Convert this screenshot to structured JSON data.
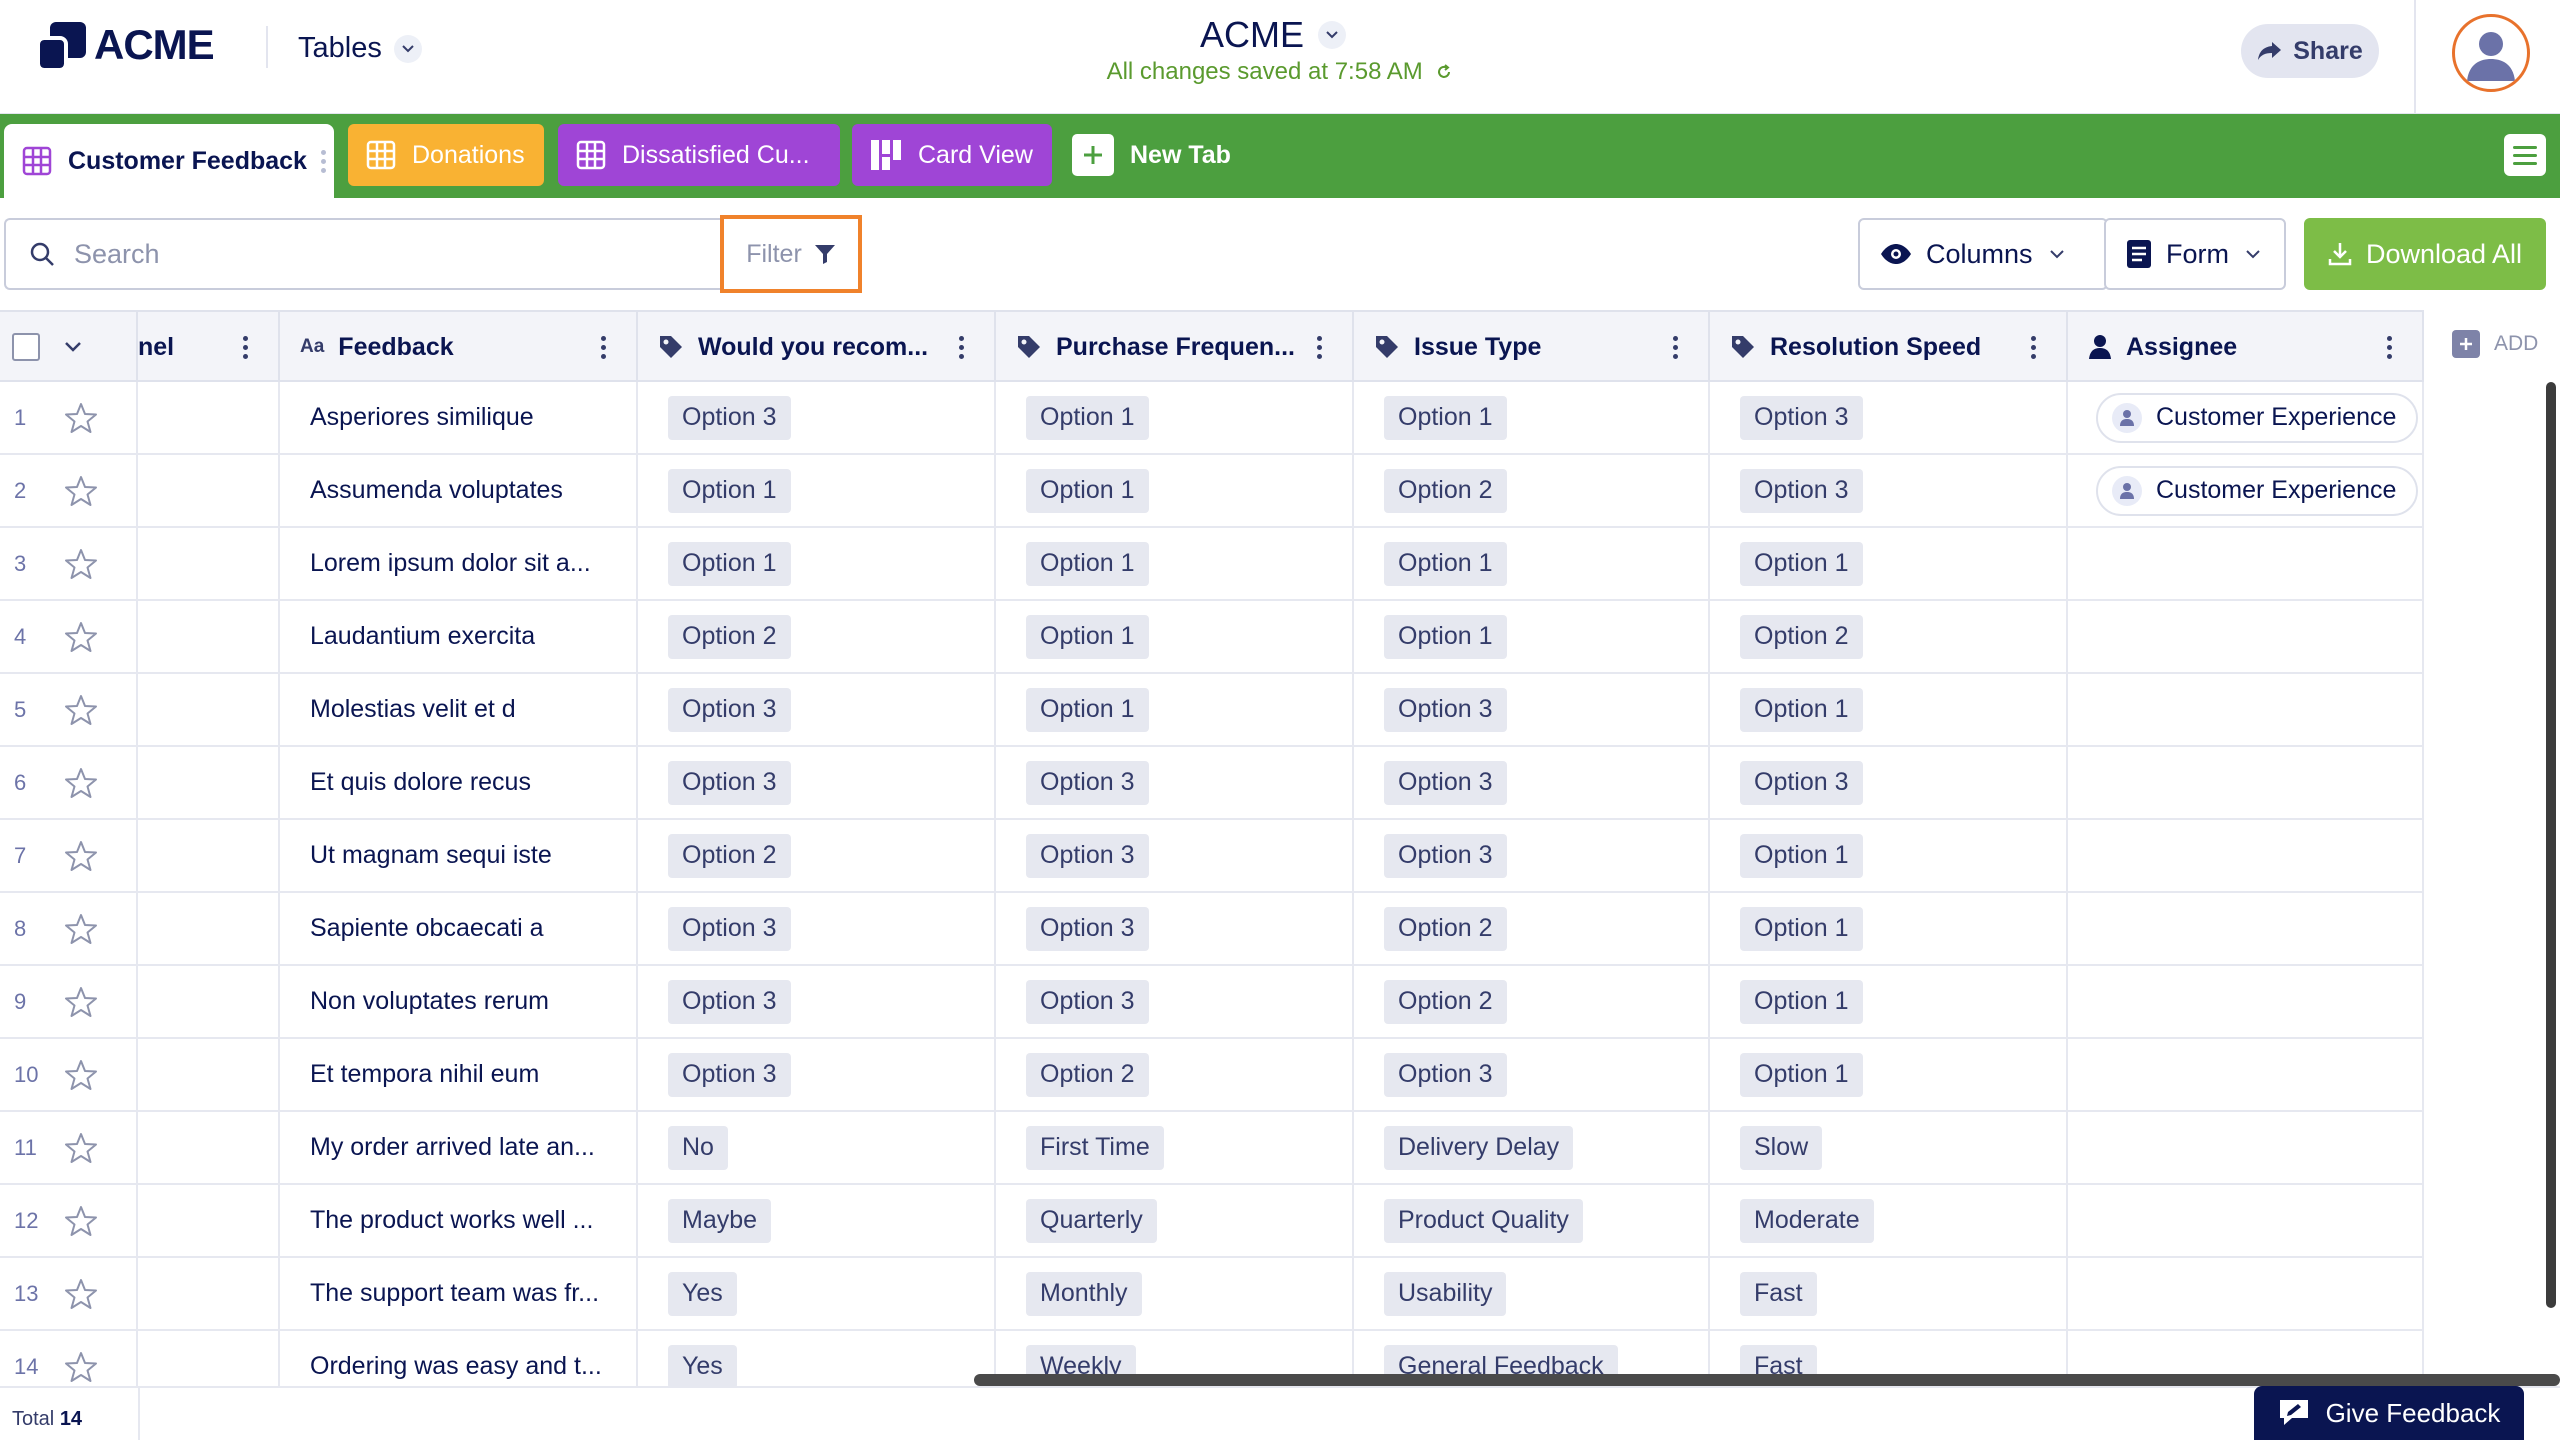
{
  "header": {
    "logo_text": "ACME",
    "tables_label": "Tables",
    "app_title": "ACME",
    "saved_status": "All changes saved at 7:58 AM",
    "share_label": "Share"
  },
  "tabs": [
    {
      "label": "Customer Feedback",
      "color": "#ffffff"
    },
    {
      "label": "Donations",
      "color": "#f9b233"
    },
    {
      "label": "Dissatisfied Cu...",
      "color": "#9f45d6"
    },
    {
      "label": "Card View",
      "color": "#9f45d6"
    },
    {
      "label": "New Tab",
      "color": "#4c9f3f"
    }
  ],
  "toolbar": {
    "search_placeholder": "Search",
    "filter_label": "Filter",
    "columns_label": "Columns",
    "form_label": "Form",
    "download_label": "Download All"
  },
  "columns": {
    "partial": "nel",
    "feedback": "Feedback",
    "recommend": "Would you recom...",
    "frequency": "Purchase Frequen...",
    "issue": "Issue Type",
    "speed": "Resolution Speed",
    "assignee": "Assignee",
    "add": "ADD"
  },
  "rows": [
    {
      "n": "1",
      "feedback": "Asperiores similique",
      "recommend": "Option 3",
      "frequency": "Option 1",
      "issue": "Option 1",
      "speed": "Option 3",
      "assignee": "Customer Experience"
    },
    {
      "n": "2",
      "feedback": "Assumenda voluptates",
      "recommend": "Option 1",
      "frequency": "Option 1",
      "issue": "Option 2",
      "speed": "Option 3",
      "assignee": "Customer Experience"
    },
    {
      "n": "3",
      "feedback": "Lorem ipsum dolor sit a...",
      "recommend": "Option 1",
      "frequency": "Option 1",
      "issue": "Option 1",
      "speed": "Option 1",
      "assignee": ""
    },
    {
      "n": "4",
      "feedback": "Laudantium exercita",
      "recommend": "Option 2",
      "frequency": "Option 1",
      "issue": "Option 1",
      "speed": "Option 2",
      "assignee": ""
    },
    {
      "n": "5",
      "feedback": "Molestias velit et d",
      "recommend": "Option 3",
      "frequency": "Option 1",
      "issue": "Option 3",
      "speed": "Option 1",
      "assignee": ""
    },
    {
      "n": "6",
      "feedback": "Et quis dolore recus",
      "recommend": "Option 3",
      "frequency": "Option 3",
      "issue": "Option 3",
      "speed": "Option 3",
      "assignee": ""
    },
    {
      "n": "7",
      "feedback": "Ut magnam sequi iste",
      "recommend": "Option 2",
      "frequency": "Option 3",
      "issue": "Option 3",
      "speed": "Option 1",
      "assignee": ""
    },
    {
      "n": "8",
      "feedback": "Sapiente obcaecati a",
      "recommend": "Option 3",
      "frequency": "Option 3",
      "issue": "Option 2",
      "speed": "Option 1",
      "assignee": ""
    },
    {
      "n": "9",
      "feedback": "Non voluptates rerum",
      "recommend": "Option 3",
      "frequency": "Option 3",
      "issue": "Option 2",
      "speed": "Option 1",
      "assignee": ""
    },
    {
      "n": "10",
      "feedback": "Et tempora nihil eum",
      "recommend": "Option 3",
      "frequency": "Option 2",
      "issue": "Option 3",
      "speed": "Option 1",
      "assignee": ""
    },
    {
      "n": "11",
      "feedback": "My order arrived late an...",
      "recommend": "No",
      "frequency": "First Time",
      "issue": "Delivery Delay",
      "speed": "Slow",
      "assignee": ""
    },
    {
      "n": "12",
      "feedback": "The product works well ...",
      "recommend": "Maybe",
      "frequency": "Quarterly",
      "issue": "Product Quality",
      "speed": "Moderate",
      "assignee": ""
    },
    {
      "n": "13",
      "feedback": "The support team was fr...",
      "recommend": "Yes",
      "frequency": "Monthly",
      "issue": "Usability",
      "speed": "Fast",
      "assignee": ""
    },
    {
      "n": "14",
      "feedback": "Ordering was easy and t...",
      "recommend": "Yes",
      "frequency": "Weekly",
      "issue": "General Feedback",
      "speed": "Fast",
      "assignee": ""
    }
  ],
  "footer": {
    "total_label": "Total",
    "total_count": "14",
    "give_feedback_label": "Give Feedback"
  },
  "icons": {
    "logo": "acme-logo-icon",
    "star": "star-outline-icon",
    "tag": "tag-icon",
    "person": "person-icon",
    "eye": "eye-icon",
    "form": "form-icon",
    "download": "download-icon",
    "filter": "funnel-icon",
    "search": "search-icon"
  },
  "colors": {
    "tab_bar": "#4c9f3f",
    "download": "#7dbd47",
    "filter_highlight": "#f0822b",
    "navy": "#0a1551"
  }
}
